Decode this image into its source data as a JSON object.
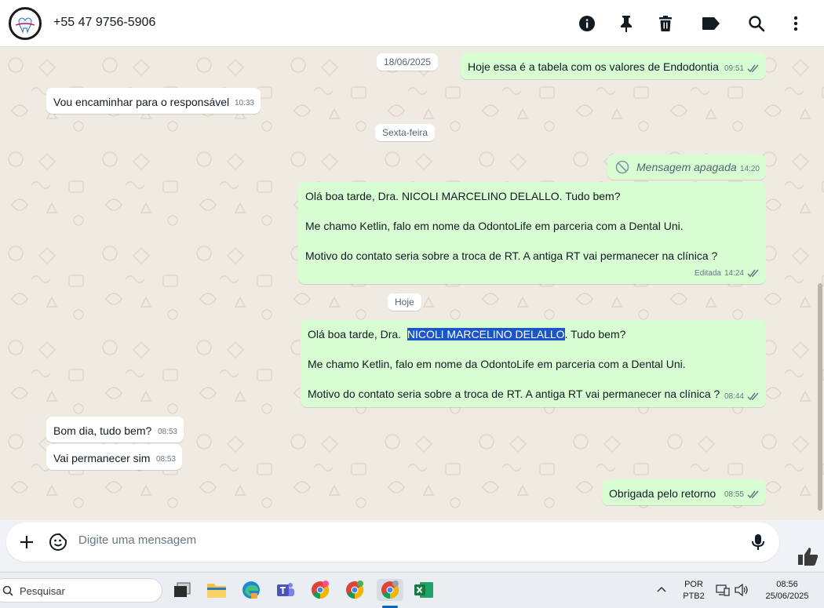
{
  "header": {
    "contact_name": "+55 47 9756-5906",
    "icons": [
      "info-icon",
      "pin-icon",
      "trash-icon",
      "label-icon",
      "search-icon",
      "menu-icon"
    ]
  },
  "messages": [
    {
      "type": "out",
      "text": "Hoje essa é a tabela com os valores de  Endodontia",
      "time": "09:51",
      "status": "read"
    },
    {
      "type": "date",
      "text": "18/06/2025"
    },
    {
      "type": "in",
      "text": "Vou encaminhar para o responsável",
      "time": "10:33"
    },
    {
      "type": "date",
      "text": "Sexta-feira"
    },
    {
      "type": "out-deleted",
      "text": "Mensagem apagada",
      "time": "14:20"
    },
    {
      "type": "out",
      "line1": "Olá boa tarde, Dra.  NICOLI MARCELINO DELALLO. Tudo bem?",
      "line2": "Me chamo Ketlin, falo em nome da OdontoLife em parceria com a Dental Uni.",
      "line3": "Motivo do contato seria sobre a troca de RT. A antiga RT vai permanecer na clínica ?",
      "edited": "Editada",
      "time": "14:24",
      "status": "read"
    },
    {
      "type": "date",
      "text": "Hoje"
    },
    {
      "type": "out",
      "line1_pre": "Olá boa tarde, Dra.  ",
      "line1_hl": "NICOLI MARCELINO DELALLO",
      "line1_post": ". Tudo bem?",
      "line2": "Me chamo Ketlin, falo em nome da OdontoLife em parceria com a Dental Uni.",
      "line3": "Motivo do contato seria sobre a troca de RT. A antiga RT vai permanecer na clínica ?",
      "time": "08:44",
      "status": "read"
    },
    {
      "type": "in",
      "text": "Bom dia, tudo bem?",
      "time": "08:53"
    },
    {
      "type": "in",
      "text": "Vai permanecer sim",
      "time": "08:53"
    },
    {
      "type": "out",
      "text": "Obrigada pelo retorno",
      "time": "08:55",
      "status": "read"
    }
  ],
  "composer": {
    "placeholder": "Digite uma mensagem"
  },
  "taskbar": {
    "search_placeholder": "Pesquisar",
    "language": "POR",
    "layout": "PTB2",
    "time": "08:56",
    "date": "25/06/2025"
  },
  "colors": {
    "chat_bg": "#efeae2",
    "incoming_bubble": "#ffffff",
    "outgoing_bubble": "#d9fdd3",
    "read_tick": "#53bdeb",
    "selection": "#1a56c7"
  }
}
